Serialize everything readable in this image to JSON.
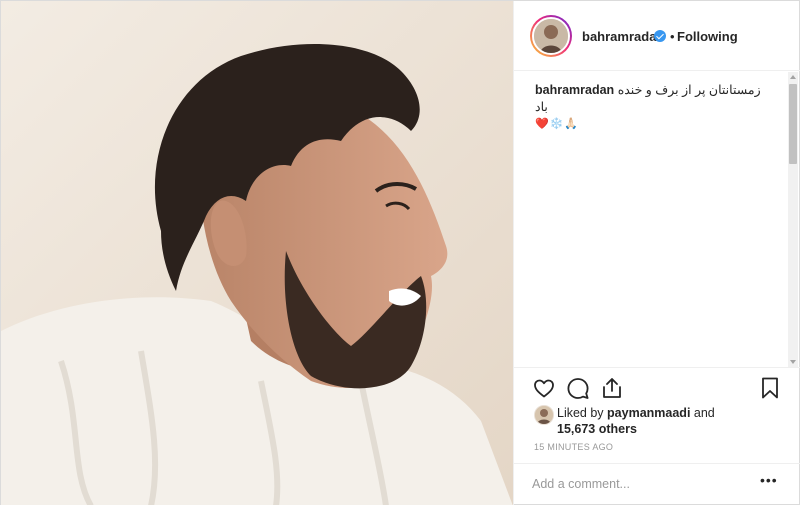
{
  "post": {
    "username": "bahramradan",
    "verified": true,
    "separator": "•",
    "follow_status": "Following"
  },
  "caption": {
    "username": "bahramradan",
    "text": "زمستانتان پر از برف و خنده باد",
    "emojis": "❤️❄️🙏🏻"
  },
  "actions": {
    "icons": [
      "heart-icon",
      "comment-icon",
      "share-icon",
      "bookmark-icon"
    ]
  },
  "likes": {
    "prefix": "Liked by",
    "liker": "paymanmaadi",
    "conjunction": "and",
    "count": "15,673 others"
  },
  "timestamp": "15 MINUTES AGO",
  "comment": {
    "placeholder": "Add a comment...",
    "more": "•••"
  },
  "colors": {
    "verified": "#3897f0",
    "border": "#efefef",
    "muted": "#999999",
    "text": "#262626"
  }
}
